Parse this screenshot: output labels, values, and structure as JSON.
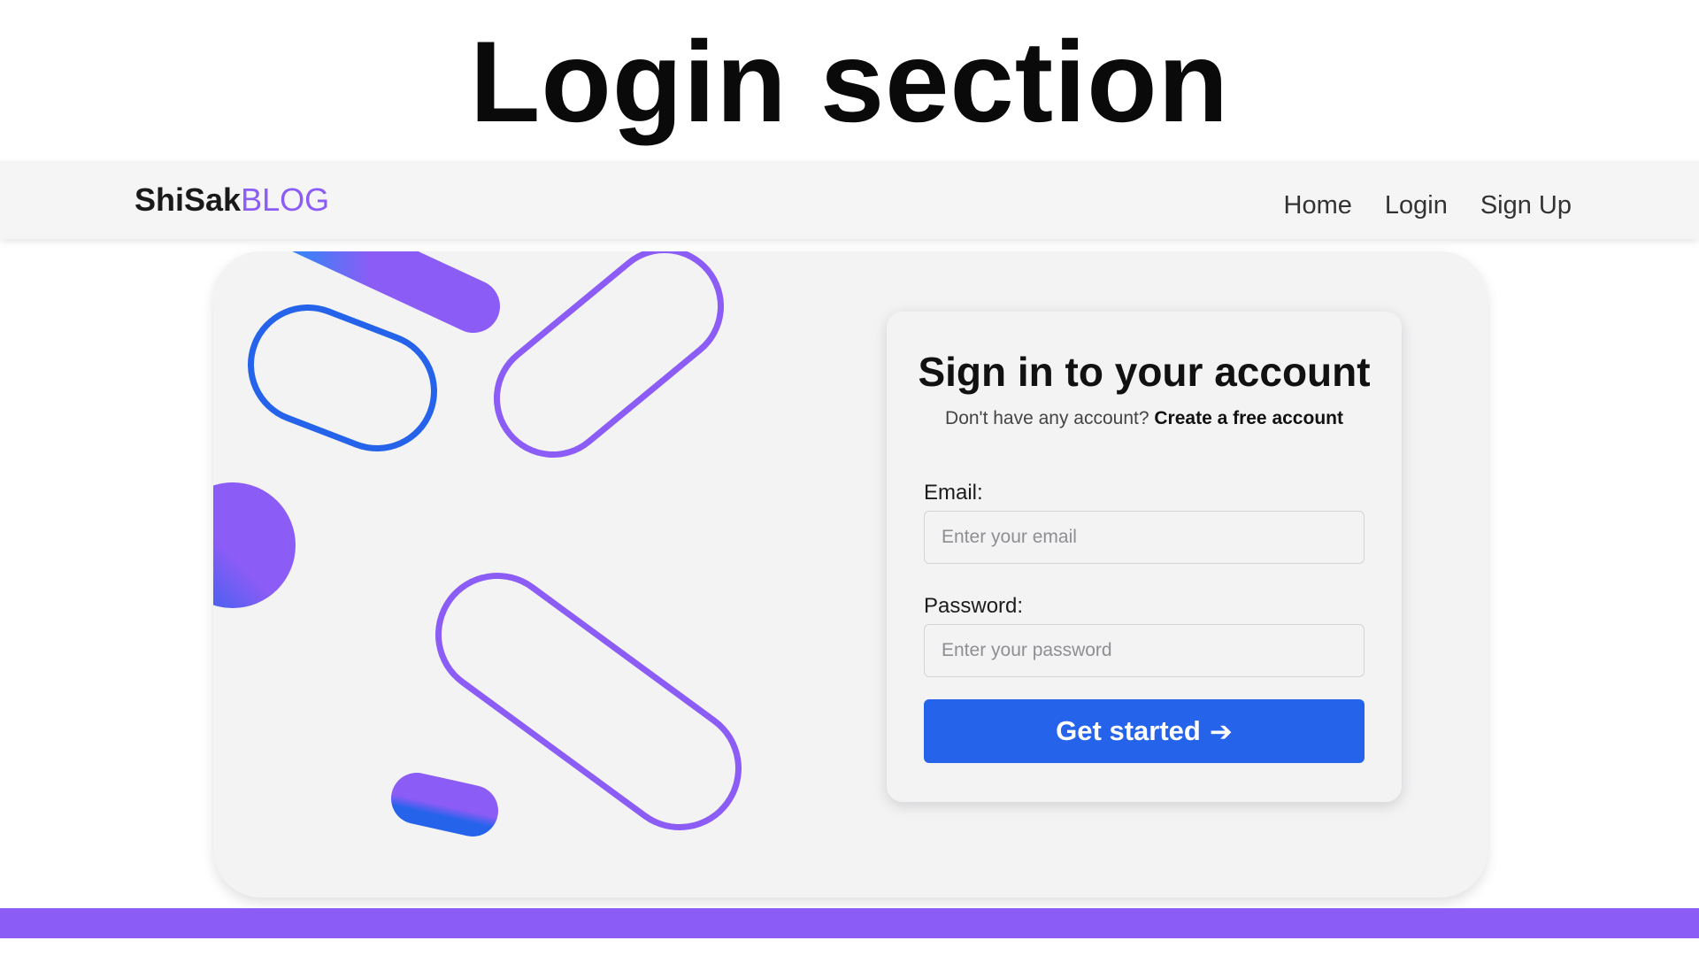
{
  "page": {
    "heading": "Login section"
  },
  "navbar": {
    "brand_primary": "ShiSak",
    "brand_accent": "BLOG",
    "links": [
      {
        "label": "Home"
      },
      {
        "label": "Login"
      },
      {
        "label": "Sign Up"
      }
    ]
  },
  "login": {
    "title": "Sign in to your account",
    "subtitle_text": "Don't have any account?",
    "subtitle_link": "Create a free account",
    "email": {
      "label": "Email:",
      "placeholder": "Enter your email",
      "value": ""
    },
    "password": {
      "label": "Password:",
      "placeholder": "Enter your password",
      "value": ""
    },
    "submit_label": "Get started",
    "submit_icon": "arrow-right-icon"
  },
  "colors": {
    "brand_accent": "#8b5cf6",
    "primary_button": "#2563eb",
    "outline_blue": "#2563eb",
    "outline_purple": "#8b5cf6",
    "card_background": "#f3f3f4",
    "bottom_bar": "#8b5cf6"
  }
}
